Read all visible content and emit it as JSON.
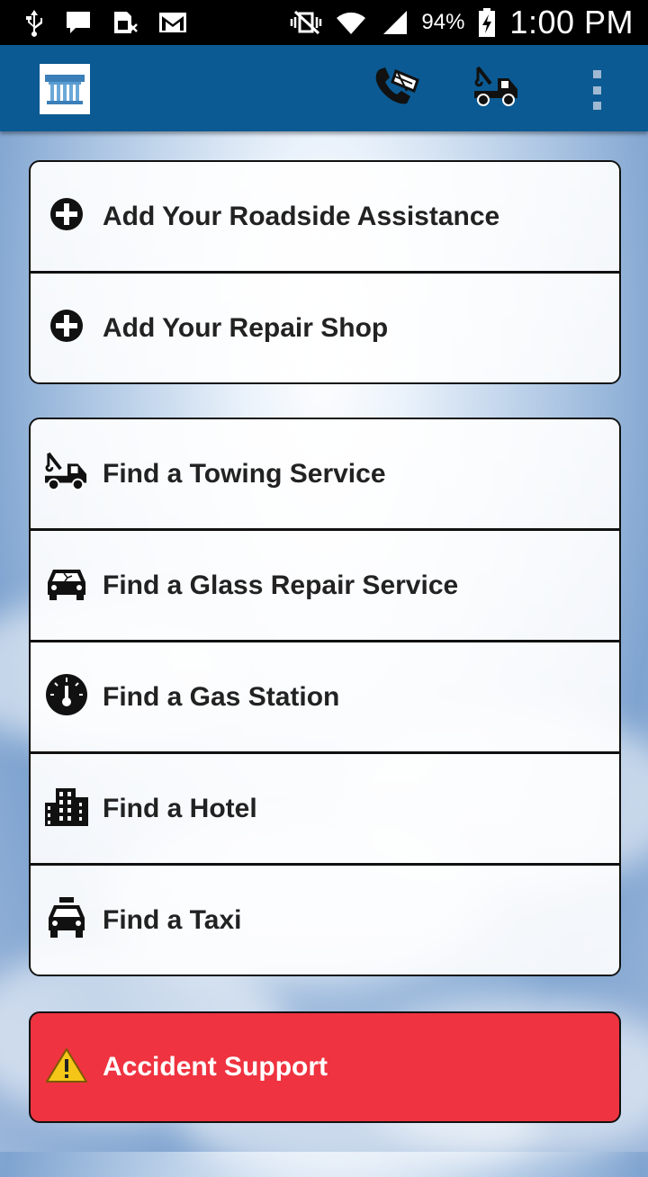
{
  "status_bar": {
    "icons": [
      "usb-icon",
      "message-icon",
      "sim-icon",
      "gmail-icon",
      "vibrate-icon",
      "wifi-icon",
      "signal-icon",
      "battery-charging-icon"
    ],
    "battery": "94%",
    "time": "1:00 PM"
  },
  "app_bar": {
    "logo_icon": "building-columns-logo",
    "actions": [
      "call-icon",
      "tow-truck-icon",
      "overflow-menu-icon"
    ]
  },
  "add_group": {
    "items": [
      {
        "icon": "plus-circle-icon",
        "label": "Add Your Roadside Assistance"
      },
      {
        "icon": "plus-circle-icon",
        "label": "Add Your Repair Shop"
      }
    ]
  },
  "find_group": {
    "items": [
      {
        "icon": "tow-truck-icon",
        "label": "Find a Towing Service"
      },
      {
        "icon": "car-glass-icon",
        "label": "Find a Glass Repair Service"
      },
      {
        "icon": "gauge-icon",
        "label": "Find a Gas Station"
      },
      {
        "icon": "hotel-icon",
        "label": "Find a Hotel"
      },
      {
        "icon": "taxi-icon",
        "label": "Find a Taxi"
      }
    ]
  },
  "accident": {
    "icon": "warning-icon",
    "label": "Accident Support",
    "color": "#ef3340"
  },
  "colors": {
    "app_bar": "#0b5a93",
    "status_bar": "#000000"
  }
}
